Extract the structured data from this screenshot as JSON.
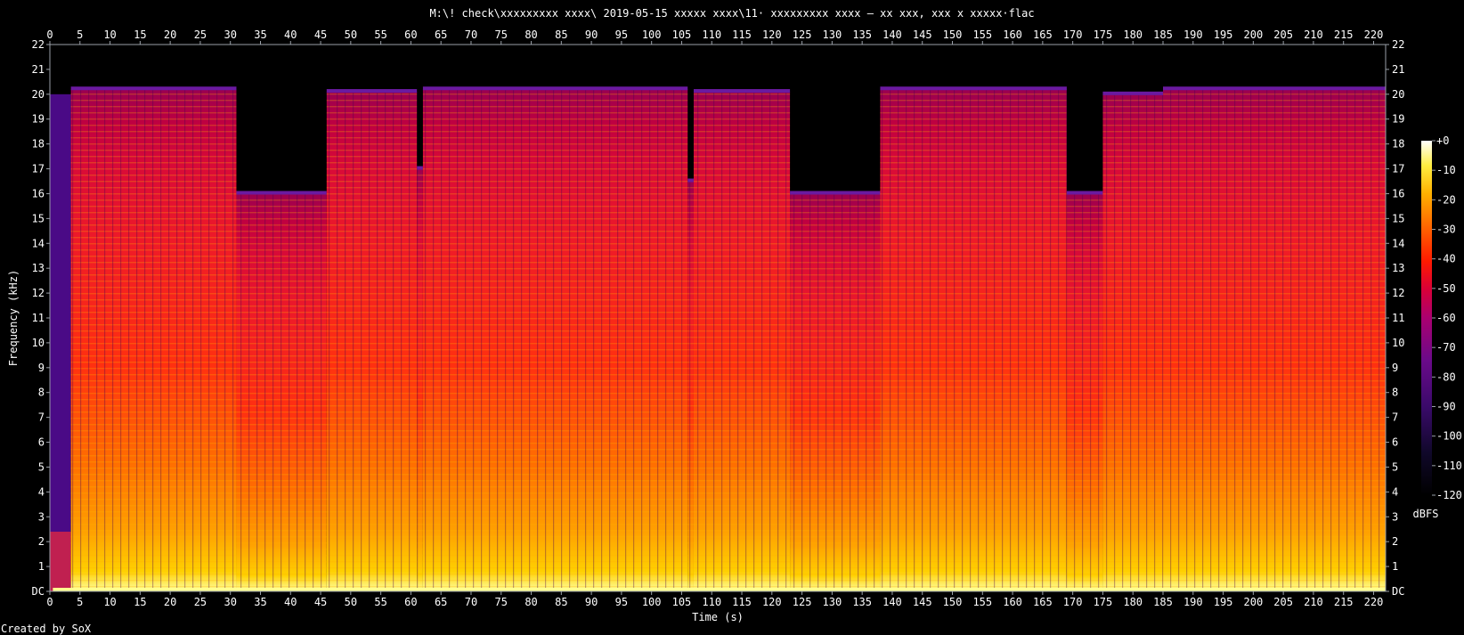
{
  "chart_data": {
    "type": "heatmap",
    "title": "M:\\! check\\xxxxxxxxx xxxx\\ 2019-05-15  xxxxx xxxx\\11· xxxxxxxxx xxxx – xx xxx, xxx x xxxxx·flac",
    "xlabel": "Time (s)",
    "ylabel": "Frequency (kHz)",
    "xlim": [
      0,
      222
    ],
    "ylim": [
      0,
      22
    ],
    "x_ticks": [
      0,
      5,
      10,
      15,
      20,
      25,
      30,
      35,
      40,
      45,
      50,
      55,
      60,
      65,
      70,
      75,
      80,
      85,
      90,
      95,
      100,
      105,
      110,
      115,
      120,
      125,
      130,
      135,
      140,
      145,
      150,
      155,
      160,
      165,
      170,
      175,
      180,
      185,
      190,
      195,
      200,
      205,
      210,
      215,
      220
    ],
    "y_ticks": [
      "DC",
      "1",
      "2",
      "3",
      "4",
      "5",
      "6",
      "7",
      "8",
      "9",
      "10",
      "11",
      "12",
      "13",
      "14",
      "15",
      "16",
      "17",
      "18",
      "19",
      "20",
      "21",
      "22"
    ],
    "colorbar": {
      "label": "dBFS",
      "range": [
        -120,
        0
      ],
      "ticks": [
        "+0",
        "-10",
        "-20",
        "-30",
        "-40",
        "-50",
        "-60",
        "-70",
        "-80",
        "-90",
        "-100",
        "-110",
        "-120"
      ]
    },
    "segments": [
      {
        "start": 0,
        "end": 3.5,
        "cutoff_khz": 20.0,
        "level": "low"
      },
      {
        "start": 3.5,
        "end": 31,
        "cutoff_khz": 20.2,
        "level": "high"
      },
      {
        "start": 31,
        "end": 46,
        "cutoff_khz": 16.0,
        "level": "high"
      },
      {
        "start": 46,
        "end": 61,
        "cutoff_khz": 20.1,
        "level": "high"
      },
      {
        "start": 61,
        "end": 62,
        "cutoff_khz": 17.0,
        "level": "high"
      },
      {
        "start": 62,
        "end": 106,
        "cutoff_khz": 20.2,
        "level": "high"
      },
      {
        "start": 106,
        "end": 107,
        "cutoff_khz": 16.5,
        "level": "high"
      },
      {
        "start": 107,
        "end": 123,
        "cutoff_khz": 20.1,
        "level": "high"
      },
      {
        "start": 123,
        "end": 138,
        "cutoff_khz": 16.0,
        "level": "high"
      },
      {
        "start": 138,
        "end": 169,
        "cutoff_khz": 20.2,
        "level": "high"
      },
      {
        "start": 169,
        "end": 175,
        "cutoff_khz": 16.0,
        "level": "high"
      },
      {
        "start": 175,
        "end": 185,
        "cutoff_khz": 20.0,
        "level": "high"
      },
      {
        "start": 185,
        "end": 222,
        "cutoff_khz": 20.2,
        "level": "high"
      }
    ]
  },
  "footer": "Created by SoX"
}
